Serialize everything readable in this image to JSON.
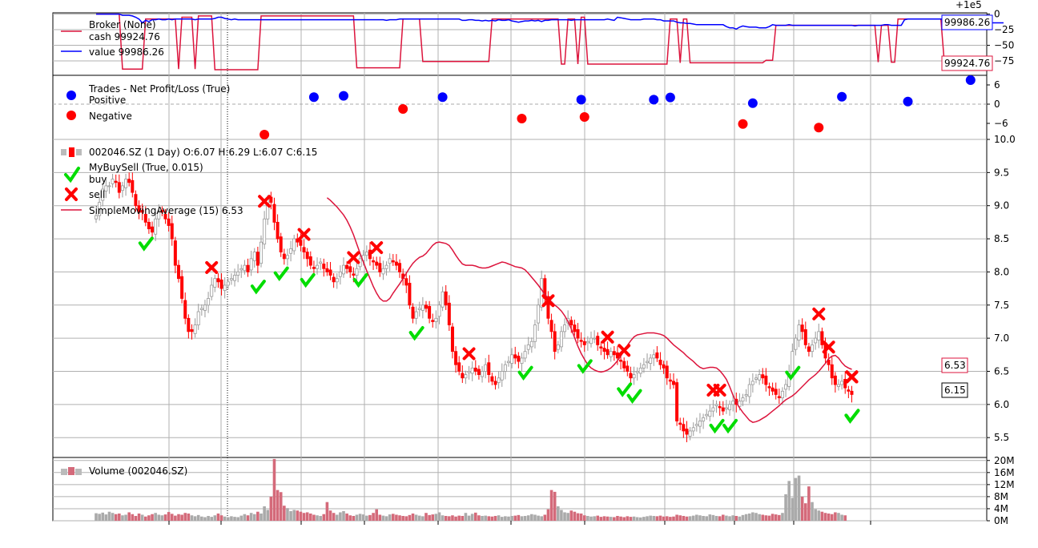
{
  "chart_data": [
    {
      "panel": "broker",
      "type": "line",
      "offset_label": "+1e5",
      "yticks": [
        "0",
        "−25",
        "−50",
        "−75"
      ],
      "ylim": [
        -98,
        2
      ],
      "legend_title": "Broker (None)",
      "series": [
        {
          "name": "cash",
          "last_value": "99924.76",
          "color": "#dc143c",
          "values": [
            0,
            0,
            0,
            0,
            0,
            0,
            0,
            0,
            -88,
            -88,
            -88,
            -88,
            -88,
            -88,
            -88,
            -8,
            -8,
            -8,
            -8,
            -8,
            -8,
            -8,
            -8,
            -8,
            -8,
            -88,
            -5,
            -5,
            -5,
            -5,
            -88,
            -3,
            -3,
            -3,
            -3,
            -3,
            -89,
            -89,
            -89,
            -89,
            -89,
            -89,
            -89,
            -89,
            -89,
            -89,
            -89,
            -89,
            -89,
            -89,
            -3,
            -3,
            -3,
            -3,
            -3,
            -3,
            -3,
            -3,
            -3,
            -3,
            -3,
            -3,
            -3,
            -3,
            -3,
            -3,
            -3,
            -3,
            -3,
            -3,
            -3,
            -3,
            -3,
            -3,
            -3,
            -3,
            -3,
            -3,
            -3,
            -86,
            -86,
            -86,
            -86,
            -86,
            -86,
            -86,
            -86,
            -86,
            -86,
            -86,
            -86,
            -86,
            -86,
            -8,
            -8,
            -8,
            -8,
            -8,
            -8,
            -76,
            -76,
            -76,
            -76,
            -76,
            -76,
            -76,
            -76,
            -76,
            -76,
            -76,
            -76,
            -76,
            -76,
            -76,
            -76,
            -76,
            -76,
            -76,
            -76,
            -76,
            -8,
            -8,
            -8,
            -8,
            -8,
            -8,
            -8,
            -8,
            -8,
            -8,
            -8,
            -8,
            -8,
            -8,
            -8,
            -8,
            -8,
            -8,
            -8,
            -8,
            -8,
            -80,
            -80,
            -8,
            -8,
            -8,
            -80,
            -5,
            -5,
            -80,
            -80,
            -80,
            -80,
            -80,
            -80,
            -80,
            -80,
            -80,
            -80,
            -80,
            -80,
            -80,
            -80,
            -80,
            -80,
            -80,
            -80,
            -80,
            -80,
            -80,
            -80,
            -80,
            -80,
            -80,
            -8,
            -8,
            -8,
            -78,
            -8,
            -8,
            -78,
            -78,
            -78,
            -78,
            -78,
            -78,
            -78,
            -78,
            -78,
            -78,
            -78,
            -78,
            -78,
            -78,
            -78,
            -78,
            -78,
            -78,
            -78,
            -78,
            -78,
            -78,
            -78,
            -74,
            -74,
            -74,
            -18,
            -18,
            -18,
            -18,
            -18,
            -18,
            -18,
            -18,
            -18,
            -18,
            -18,
            -18,
            -18,
            -18,
            -18,
            -18,
            -18,
            -18,
            -18,
            -18,
            -18,
            -18,
            -18,
            -18,
            -18,
            -18,
            -18,
            -18,
            -18,
            -18,
            -18,
            -77,
            -18,
            -18,
            -18,
            -77,
            -77,
            -8,
            -8,
            -8,
            -8,
            -8,
            -8,
            -8,
            -8,
            -8,
            -8,
            -8,
            -8,
            -8,
            -8,
            -74,
            -74,
            -74,
            -74,
            -74,
            -74,
            -74,
            -74,
            -74,
            -74,
            -75
          ]
        },
        {
          "name": "value",
          "last_value": "99986.26",
          "color": "#0000ff",
          "values": [
            0,
            0,
            0,
            0,
            0,
            0,
            0,
            0,
            -2,
            -2,
            -2,
            -3,
            -5,
            -8,
            -14,
            -10,
            -12,
            -9,
            -9,
            -8,
            -9,
            -9,
            -8,
            -9,
            -8,
            -8,
            -8,
            -8,
            -8,
            -8,
            -9,
            -8,
            -8,
            -8,
            -8,
            -8,
            -7,
            -5,
            -5,
            -7,
            -8,
            -9,
            -8,
            -9,
            -9,
            -9,
            -9,
            -9,
            -9,
            -9,
            -9,
            -9,
            -9,
            -9,
            -9,
            -9,
            -9,
            -9,
            -9,
            -9,
            -9,
            -9,
            -9,
            -9,
            -9,
            -9,
            -9,
            -9,
            -9,
            -9,
            -9,
            -9,
            -9,
            -9,
            -9,
            -9,
            -9,
            -9,
            -9,
            -9,
            -9,
            -9,
            -9,
            -9,
            -9,
            -9,
            -9,
            -9,
            -10,
            -9,
            -9,
            -9,
            -8,
            -8,
            -8,
            -8,
            -8,
            -8,
            -8,
            -8,
            -8,
            -8,
            -8,
            -8,
            -8,
            -8,
            -8,
            -8,
            -8,
            -8,
            -8,
            -10,
            -10,
            -9,
            -9,
            -10,
            -10,
            -11,
            -10,
            -11,
            -10,
            -11,
            -9,
            -10,
            -10,
            -9,
            -11,
            -12,
            -13,
            -12,
            -11,
            -11,
            -10,
            -11,
            -10,
            -12,
            -10,
            -10,
            -9,
            -9,
            -9,
            -9,
            -9,
            -9,
            -10,
            -9,
            -9,
            -9,
            -9,
            -9,
            -9,
            -9,
            -9,
            -9,
            -9,
            -8,
            -9,
            -10,
            -5,
            -6,
            -7,
            -8,
            -9,
            -9,
            -9,
            -9,
            -8,
            -8,
            -8,
            -8,
            -9,
            -9,
            -11,
            -11,
            -11,
            -11,
            -13,
            -14,
            -14,
            -15,
            -15,
            -16,
            -17,
            -17,
            -17,
            -17,
            -17,
            -17,
            -17,
            -17,
            -17,
            -20,
            -22,
            -22,
            -24,
            -21,
            -19,
            -20,
            -21,
            -21,
            -21,
            -22,
            -22,
            -22,
            -20,
            -17,
            -18,
            -18,
            -18,
            -18,
            -17,
            -18,
            -18,
            -18,
            -18,
            -18,
            -18,
            -18,
            -18,
            -18,
            -18,
            -18,
            -18,
            -18,
            -18,
            -18,
            -18,
            -18,
            -18,
            -18,
            -19,
            -18,
            -18,
            -18,
            -18,
            -18,
            -18,
            -18,
            -18,
            -17,
            -17,
            -18,
            -18,
            -18,
            -18,
            -9,
            -8,
            -8,
            -8,
            -8,
            -8,
            -8,
            -8,
            -8,
            -8,
            -8,
            -8,
            -8,
            -8,
            -8,
            -8,
            -10,
            -10,
            -12,
            -13,
            -14,
            -14,
            -14,
            -14,
            -14,
            -14,
            -14,
            -14,
            -14,
            -14,
            -14
          ]
        }
      ]
    },
    {
      "panel": "trades",
      "type": "scatter",
      "yticks": [
        "6",
        "0",
        "−6"
      ],
      "ylim": [
        -11,
        9
      ],
      "legend_title": "Trades - Net Profit/Loss (True)",
      "series": [
        {
          "name": "Positive",
          "color": "#0000ff",
          "x": [
            66,
            75,
            105,
            147,
            169,
            174,
            199,
            226,
            246,
            265
          ],
          "y": [
            2.2,
            2.6,
            2.2,
            1.4,
            1.4,
            2.1,
            0.3,
            2.3,
            0.8,
            7.5
          ]
        },
        {
          "name": "Negative",
          "color": "#ff0000",
          "x": [
            51,
            93,
            129,
            148,
            196,
            219
          ],
          "y": [
            -9.5,
            -1.5,
            -4.5,
            -4.0,
            -6.2,
            -7.3
          ]
        }
      ]
    },
    {
      "panel": "price",
      "type": "candlestick",
      "ylim": [
        5.2,
        10.0
      ],
      "yticks": [
        "5.5",
        "6.0",
        "6.5",
        "7.0",
        "7.5",
        "8.0",
        "8.5",
        "9.0",
        "9.5",
        "10.0"
      ],
      "legend": [
        {
          "label": "002046.SZ (1 Day) O:6.07 H:6.29 L:6.07 C:6.15"
        },
        {
          "label": "MyBuySell (True, 0.015)"
        },
        {
          "label": "buy"
        },
        {
          "label": "sell"
        },
        {
          "label": "SimpleMovingAverage (15) 6.53"
        }
      ],
      "sma_tag": "6.53",
      "close_tag": "6.15",
      "close": [
        8.85,
        9.05,
        9.25,
        9.3,
        9.3,
        9.4,
        9.35,
        9.2,
        9.3,
        9.4,
        9.35,
        9.2,
        9.0,
        8.9,
        8.9,
        8.75,
        8.65,
        8.6,
        8.8,
        8.9,
        8.9,
        8.8,
        8.7,
        8.5,
        8.1,
        7.9,
        7.6,
        7.3,
        7.1,
        7.1,
        7.2,
        7.4,
        7.45,
        7.5,
        7.6,
        7.8,
        7.9,
        7.85,
        7.75,
        7.8,
        7.85,
        7.9,
        7.95,
        8.0,
        8.05,
        8.1,
        8.0,
        8.2,
        8.3,
        8.1,
        8.45,
        8.8,
        9.1,
        9.05,
        8.75,
        8.5,
        8.3,
        8.2,
        8.25,
        8.35,
        8.5,
        8.45,
        8.4,
        8.3,
        8.2,
        8.1,
        8.05,
        8.1,
        8.15,
        8.05,
        8.0,
        7.95,
        7.85,
        7.9,
        8.0,
        8.1,
        8.05,
        8.0,
        7.95,
        8.05,
        8.2,
        8.25,
        8.3,
        8.2,
        8.15,
        8.1,
        8.0,
        8.05,
        8.1,
        8.2,
        8.15,
        8.1,
        8.0,
        7.9,
        7.8,
        7.5,
        7.3,
        7.4,
        7.45,
        7.5,
        7.45,
        7.3,
        7.25,
        7.3,
        7.5,
        7.7,
        7.5,
        7.2,
        6.8,
        6.6,
        6.5,
        6.4,
        6.45,
        6.5,
        6.55,
        6.5,
        6.45,
        6.5,
        6.6,
        6.45,
        6.35,
        6.3,
        6.4,
        6.5,
        6.6,
        6.65,
        6.75,
        6.7,
        6.65,
        6.7,
        6.8,
        6.9,
        6.95,
        7.2,
        7.5,
        7.9,
        7.6,
        7.3,
        7.1,
        6.8,
        6.9,
        7.1,
        7.2,
        7.3,
        7.2,
        7.1,
        7.0,
        6.95,
        6.9,
        6.95,
        7.0,
        7.0,
        6.9,
        6.85,
        6.8,
        6.75,
        6.8,
        6.75,
        6.7,
        6.65,
        6.55,
        6.5,
        6.4,
        6.45,
        6.5,
        6.55,
        6.6,
        6.65,
        6.7,
        6.75,
        6.7,
        6.6,
        6.55,
        6.4,
        6.35,
        6.3,
        5.75,
        5.7,
        5.6,
        5.55,
        5.6,
        5.65,
        5.7,
        5.75,
        5.8,
        5.85,
        5.9,
        5.95,
        6.0,
        5.95,
        5.9,
        5.95,
        6.0,
        6.05,
        6.0,
        6.05,
        6.1,
        6.15,
        6.3,
        6.35,
        6.4,
        6.45,
        6.4,
        6.3,
        6.25,
        6.2,
        6.15,
        6.1,
        6.2,
        6.3,
        6.5,
        6.8,
        7.0,
        7.2,
        7.1,
        6.9,
        6.8,
        6.9,
        7.0,
        7.1,
        6.9,
        6.7,
        6.6,
        6.4,
        6.3,
        6.3,
        6.35,
        6.25,
        6.2,
        6.15
      ],
      "sma": [
        9.12,
        9.08,
        9.03,
        8.98,
        8.92,
        8.86,
        8.78,
        8.68,
        8.56,
        8.42,
        8.28,
        8.15,
        8.02,
        7.9,
        7.78,
        7.68,
        7.6,
        7.56,
        7.56,
        7.6,
        7.68,
        7.75,
        7.82,
        7.9,
        7.98,
        8.06,
        8.13,
        8.18,
        8.22,
        8.24,
        8.28,
        8.34,
        8.4,
        8.44,
        8.45,
        8.44,
        8.43,
        8.4,
        8.33,
        8.25,
        8.18,
        8.12,
        8.1,
        8.1,
        8.1,
        8.09,
        8.07,
        8.06,
        8.06,
        8.07,
        8.09,
        8.11,
        8.13,
        8.15,
        8.14,
        8.12,
        8.1,
        8.08,
        8.07,
        8.06,
        8.03,
        7.98,
        7.92,
        7.86,
        7.8,
        7.73,
        7.66,
        7.6,
        7.55,
        7.5,
        7.46,
        7.41,
        7.34,
        7.25,
        7.14,
        7.01,
        6.88,
        6.77,
        6.68,
        6.6,
        6.55,
        6.52,
        6.5,
        6.49,
        6.5,
        6.52,
        6.55,
        6.6,
        6.66,
        6.73,
        6.81,
        6.89,
        6.96,
        7.02,
        7.05,
        7.06,
        7.07,
        7.08,
        7.08,
        7.08,
        7.07,
        7.06,
        7.04,
        7.0,
        6.95,
        6.9,
        6.86,
        6.82,
        6.78,
        6.73,
        6.69,
        6.65,
        6.6,
        6.56,
        6.54,
        6.55,
        6.56,
        6.56,
        6.55,
        6.51,
        6.45,
        6.38,
        6.27,
        6.14,
        6.03,
        5.95,
        5.88,
        5.82,
        5.76,
        5.73,
        5.74,
        5.76,
        5.79,
        5.82,
        5.86,
        5.9,
        5.94,
        5.98,
        6.03,
        6.07,
        6.1,
        6.13,
        6.17,
        6.22,
        6.27,
        6.32,
        6.37,
        6.41,
        6.45,
        6.5,
        6.56,
        6.62,
        6.69,
        6.73,
        6.74,
        6.7,
        6.63,
        6.58,
        6.55,
        6.53
      ]
    },
    {
      "panel": "volume",
      "type": "bar",
      "legend": "Volume (002046.SZ)",
      "yticks": [
        "20M",
        "16M",
        "12M",
        "8M",
        "4M",
        "0M"
      ],
      "ylim": [
        0,
        21
      ],
      "values_M": [
        2.5,
        2.3,
        2.7,
        2.1,
        3.0,
        2.6,
        2.2,
        2.4,
        1.8,
        2.0,
        2.8,
        2.2,
        1.6,
        2.4,
        2.0,
        1.4,
        1.8,
        2.2,
        2.6,
        2.0,
        1.8,
        2.1,
        2.9,
        2.3,
        1.7,
        2.2,
        2.0,
        2.6,
        2.4,
        1.8,
        1.5,
        1.9,
        1.4,
        1.2,
        1.6,
        1.3,
        1.8,
        2.4,
        1.8,
        1.4,
        1.2,
        1.5,
        1.3,
        1.2,
        1.7,
        2.2,
        1.8,
        2.6,
        2.2,
        3.0,
        2.4,
        4.8,
        3.6,
        8.0,
        20.5,
        10.2,
        9.5,
        5.0,
        4.2,
        3.2,
        3.6,
        3.4,
        3.0,
        2.6,
        2.8,
        2.4,
        2.0,
        1.8,
        1.6,
        2.2,
        6.2,
        3.4,
        2.6,
        2.0,
        2.8,
        3.2,
        2.4,
        1.8,
        1.6,
        2.0,
        2.3,
        2.1,
        1.7,
        1.9,
        2.6,
        3.8,
        2.0,
        1.7,
        1.5,
        2.1,
        2.3,
        2.0,
        1.8,
        1.6,
        1.5,
        1.9,
        2.4,
        2.0,
        1.7,
        1.5,
        2.6,
        1.9,
        2.1,
        2.3,
        2.8,
        1.8,
        1.6,
        1.5,
        1.8,
        1.4,
        1.7,
        1.6,
        2.6,
        1.7,
        2.3,
        2.7,
        1.8,
        1.6,
        1.7,
        1.5,
        1.4,
        1.6,
        1.8,
        1.3,
        1.5,
        1.4,
        1.6,
        1.7,
        1.9,
        1.5,
        1.6,
        1.8,
        2.2,
        2.0,
        1.7,
        1.5,
        2.0,
        3.8,
        10.2,
        9.6,
        4.8,
        3.6,
        2.8,
        2.6,
        3.4,
        3.0,
        2.5,
        2.4,
        1.8,
        1.6,
        1.4,
        1.5,
        1.7,
        1.3,
        1.5,
        1.4,
        1.3,
        1.2,
        1.6,
        1.4,
        1.2,
        1.5,
        1.3,
        1.4,
        1.2,
        1.1,
        1.3,
        1.5,
        1.7,
        1.6,
        1.5,
        1.7,
        1.4,
        1.5,
        1.3,
        1.4,
        2.0,
        1.8,
        1.6,
        1.4,
        1.5,
        1.7,
        2.0,
        1.8,
        1.6,
        1.5,
        2.1,
        1.9,
        1.6,
        1.5,
        2.0,
        1.7,
        1.5,
        1.8,
        1.6,
        1.4,
        1.9,
        2.2,
        2.4,
        2.8,
        2.6,
        2.2,
        2.0,
        1.8,
        1.7,
        2.3,
        2.1,
        1.9,
        2.6,
        8.8,
        13.2,
        7.6,
        14.2,
        15.0,
        8.0,
        5.8,
        11.4,
        6.2,
        3.8,
        3.4,
        3.0,
        2.6,
        2.4,
        2.2,
        2.8,
        2.6,
        2.0,
        1.8
      ]
    }
  ]
}
